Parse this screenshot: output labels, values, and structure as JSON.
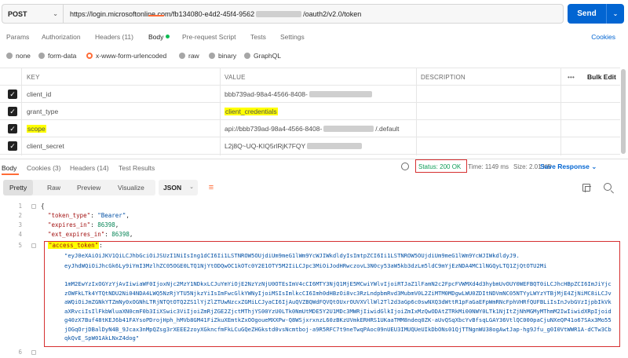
{
  "request": {
    "method": "POST",
    "url_prefix": "https://login.microsoftonline.com/fb134080-e4d2-45f4-9562",
    "url_suffix": "/oauth2/v2.0/token",
    "send_label": "Send"
  },
  "request_tabs": {
    "params": "Params",
    "authorization": "Authorization",
    "headers": "Headers (11)",
    "body": "Body",
    "pre_request": "Pre-request Script",
    "tests": "Tests",
    "settings": "Settings",
    "cookies": "Cookies"
  },
  "body_types": [
    "none",
    "form-data",
    "x-www-form-urlencoded",
    "raw",
    "binary",
    "GraphQL"
  ],
  "body_type_selected": "x-www-form-urlencoded",
  "params_table": {
    "headers": {
      "key": "KEY",
      "value": "VALUE",
      "description": "DESCRIPTION",
      "more": "•••",
      "bulk_edit": "Bulk Edit"
    },
    "rows": [
      {
        "key": "client_id",
        "value": "bbb739ad-98a4-4566-8408-",
        "value_tail": "",
        "checked": true
      },
      {
        "key": "grant_type",
        "value": "client_credentials",
        "value_tail": "",
        "checked": true
      },
      {
        "key": "scope",
        "value": "api://bbb739ad-98a4-4566-8408-",
        "value_tail": "/.default",
        "checked": true
      },
      {
        "key": "client_secret",
        "value": "L2j8Q~UQ-KIQ5rlRjK7FQY",
        "value_tail": "",
        "checked": true
      }
    ]
  },
  "response_tabs": {
    "body": "Body",
    "cookies": "Cookies (3)",
    "headers": "Headers (14)",
    "test_results": "Test Results",
    "status": "Status: 200 OK",
    "time": "Time: 1149 ms",
    "size": "Size: 2.01 KB",
    "save_response": "Save Response"
  },
  "response_toolbar": {
    "views": [
      "Pretty",
      "Raw",
      "Preview",
      "Visualize"
    ],
    "active_view": "Pretty",
    "format": "JSON"
  },
  "code": {
    "line_numbers": [
      "1",
      "2",
      "3",
      "4",
      "5",
      "6"
    ],
    "open_brace": "{",
    "token_type_key": "\"token_type\"",
    "token_type_value": "\"Bearer\"",
    "expires_in_key": "\"expires_in\"",
    "expires_in_value": "86398",
    "ext_expires_in_key": "\"ext_expires_in\"",
    "ext_expires_in_value": "86398",
    "access_token_key": "\"access_token\"",
    "access_token_lines": [
      "\"eyJ0eXAiOiJKV1QiLCJhbGciOiJSUzI1NiIsIng1dCI6Ii1LSTNROW5OUjdiUm9meG1lWm9YcWJIWkdldyIsImtpZCI6Ii1LSTNROW5OUjdiUm9meG1lWm9YcWJIWkdldyJ9.",
      "eyJhdWQiOiJhcGk6Ly9iYmI3MzlhZC05OGE0LTQ1NjYtODQwOC1kOTc0Y2E1OTY5M2IiLCJpc3MiOiJodHRwczovL3N0cy53aW5kb3dzLm5ldC9mYjEzNDA4MC1lNGQyLTQ1ZjQtOTU2Mi",
      "1mM2EwYzIxOGYzYjAvIiwiaWF0IjoxNjc2MzY1NDkxLCJuYmYiOjE2NzYzNjU0OTEsImV4cCI6MTY3NjQ1MjE5MCwiYWlvIjoiRTJaZ1lFamN2c2FpcFVWMXd4d3hybmUvOUY0WEFBQT0iLCJhcHBpZCI6ImJiYjczOWFkLTk4YTQtNDU2Ni04NDA4LWQ5NzRjYTU5NjkzYiIsImFwcGlkYWNyIjoiMSIsImlkcCI6Imh0dHBzOi8vc3RzLndpbmRvd3MubmV0L2ZiMTM0MDgwLWU0ZDItNDVmNC05NTYyLWYzYTBjMjE4ZjNiMC8iLCJvaWQiOiJmZGNkYTZmNy0xOGNhLTRjNTQtOTQ2ZS1lYjZlZTUwNzcxZGMiLCJyaCI6IjAuQVZBQWdFQVQtOUxrOUVXVllWl2Tl2d3aGp6c0swNXQ3dWttR1pFaGaEFpWmRNcFphVHRfQUFBLiIsInJvbGVzIjpbIkVkaXRvciIsIlFkbWluaXN0cmF0b3IiXSwic3ViIjoiZmRjZGE2ZjctMThjYS00YzU0LTk0NmUtMDE5Y2U1MDc3MWRjIiwidGlkIjoiZmIxMzQwODAtZTRkMi00NWY0LTk1NjItZjNhMGMyMThmM2IwIiwidXRpIjoid1p3bXE3WWY3RXlFS2xLYlYxMFNBQSIsInZlciI6IjEuMCJ9.",
      "g40zX7Buf48tKEJ6b41FAYsoPDrojHph_hMVb8GM41FiZkuXEmtkZxOOgoueMXXPw-Q8WSjxrxnzL60zBKzUVmkERHRS1UKaaTMM8ndeq0ZK-aUvQSqXbcYvBfsqLGAY36VtlQC000paCjuNXeQP41o67SAx3Mo55jOGqOrjDBalDyN4B_9Jcax3nMpQZsg3rXEEE2zoyXGkncfmFkLCuGQeZHGkstd0vsNcmtboj-a9R5RFC7t9neTwqPAoc09nUEU3IMUQUeUIkDbONs01QjTTNgnWU38ogAwtJap-hg9Jfu_g0I0VtWWR1A-dCTw3CbqkQvE_SpW01AkLNxZ4dog\""
    ]
  },
  "colors": {
    "accent": "#ff6c37",
    "send": "#0265d2",
    "status_ok": "#0f9d58",
    "highlight": "#ffff00",
    "annotation": "#d63031"
  }
}
